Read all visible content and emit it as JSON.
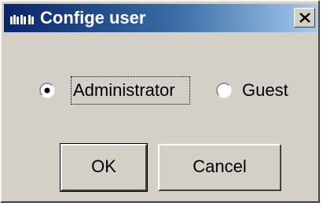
{
  "dialog": {
    "title": "Confige user",
    "close_symbol": "X"
  },
  "options": [
    {
      "label": "Administrator",
      "selected": true
    },
    {
      "label": "Guest",
      "selected": false
    }
  ],
  "buttons": {
    "ok_label": "OK",
    "cancel_label": "Cancel"
  },
  "icons": {
    "title_icon": "app-icon",
    "close_icon": "close-icon"
  }
}
